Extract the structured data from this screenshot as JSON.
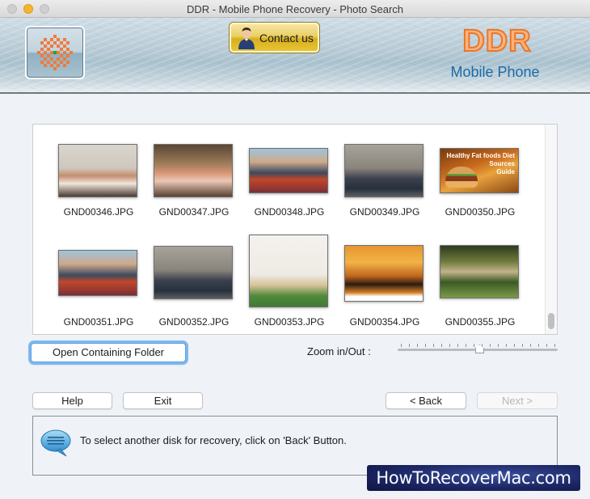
{
  "window": {
    "title": "DDR - Mobile Phone Recovery - Photo Search"
  },
  "header": {
    "contact_label": "Contact us",
    "brand_name": "DDR",
    "brand_subtitle": "Mobile Phone"
  },
  "gallery": {
    "rows": [
      [
        {
          "filename": "GND00346.JPG",
          "description": "three women holding flowers"
        },
        {
          "filename": "GND00347.JPG",
          "description": "family talking in living room"
        },
        {
          "filename": "GND00348.JPG",
          "description": "three friends sitting on bench"
        },
        {
          "filename": "GND00349.JPG",
          "description": "group selfie by stone wall"
        },
        {
          "filename": "GND00350.JPG",
          "description": "Healthy Fat foods Diet Sources Guide burger image",
          "caption_lines": [
            "Healthy Fat foods Diet",
            "Sources",
            "Guide"
          ]
        }
      ],
      [
        {
          "filename": "GND00351.JPG",
          "description": "three friends sitting on bench"
        },
        {
          "filename": "GND00352.JPG",
          "description": "group selfie by stone wall"
        },
        {
          "filename": "GND00353.JPG",
          "description": "children playing with balls"
        },
        {
          "filename": "GND00354.JPG",
          "description": "pavilion at sunset over lake"
        },
        {
          "filename": "GND00355.JPG",
          "description": "girl running in garden"
        }
      ]
    ],
    "scroll_position": 0.95
  },
  "actions": {
    "open_folder_label": "Open Containing Folder",
    "zoom_label": "Zoom in/Out :",
    "zoom_value": 0.51,
    "zoom_ticks": 20
  },
  "nav": {
    "help_label": "Help",
    "exit_label": "Exit",
    "back_label": "< Back",
    "next_label": "Next >"
  },
  "status": {
    "message": "To select another disk for recovery, click on 'Back' Button."
  },
  "watermark": {
    "text": "HowToRecoverMac.com"
  },
  "colors": {
    "brand_orange": "#e8762e",
    "brand_blue": "#1b6aa8",
    "focus_blue": "#5aa1e0",
    "window_bg": "#eff2f7"
  }
}
